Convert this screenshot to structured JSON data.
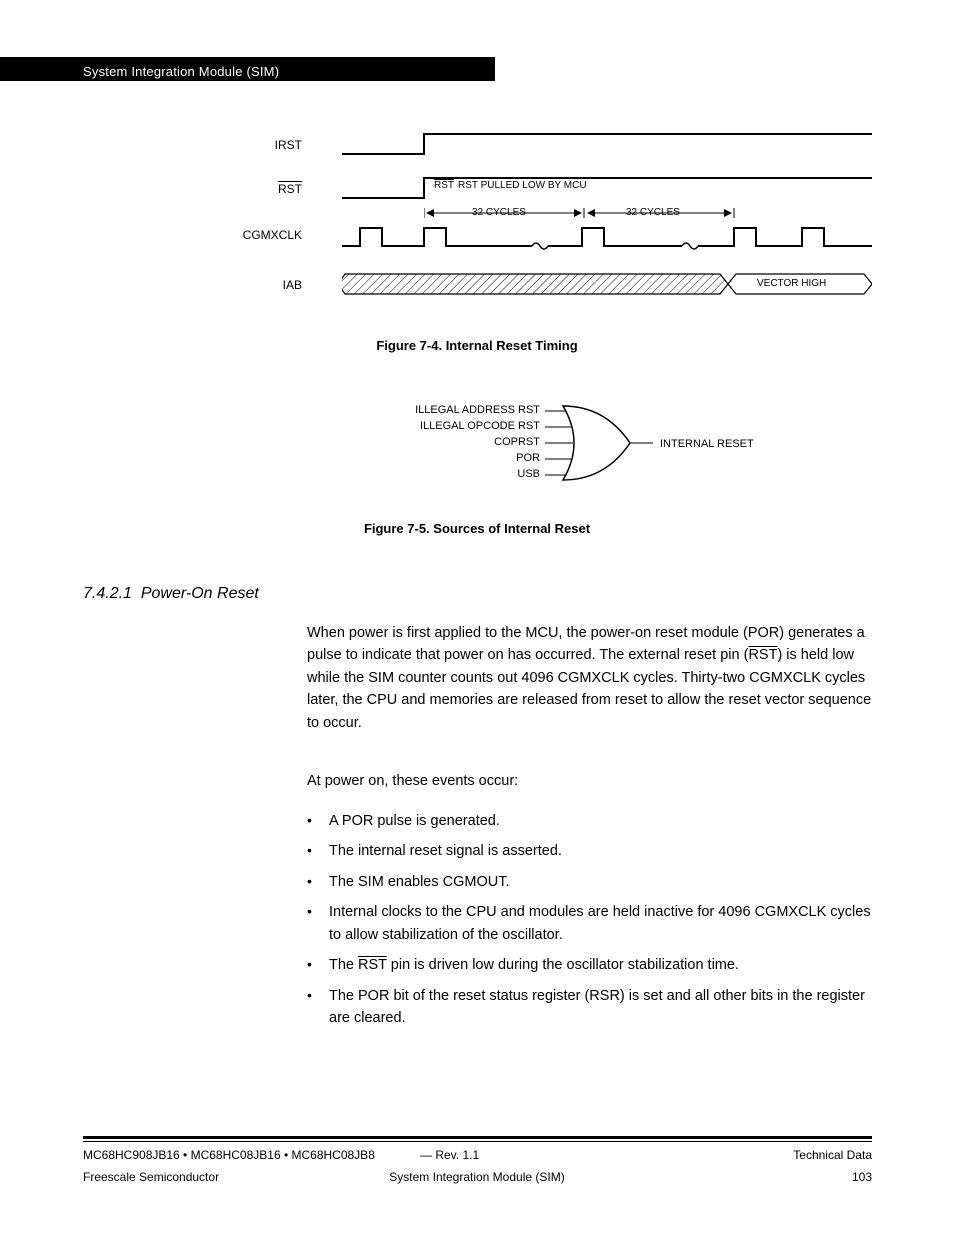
{
  "header": {
    "title": "System Integration Module (SIM)"
  },
  "timing": {
    "signals": {
      "irst": "IRST",
      "rst": "RST",
      "cgmxclk": "CGMXCLK",
      "iab": "IAB"
    },
    "notes": {
      "rst_pulled_low": "RST PULLED LOW BY MCU",
      "cycles_a": "32 CYCLES",
      "cycles_b": "32 CYCLES",
      "vector_high": "VECTOR HIGH"
    },
    "caption": "Figure 7-4. Internal Reset Timing"
  },
  "or_diagram": {
    "inputs": [
      "ILLEGAL ADDRESS RST",
      "ILLEGAL OPCODE RST",
      "COPRST",
      "POR",
      "USB"
    ],
    "output": "INTERNAL RESET",
    "caption": "Figure 7-5. Sources of Internal Reset"
  },
  "section": {
    "number": "7.4.2.1",
    "title": "Power-On Reset"
  },
  "body": {
    "p1_pre": "When power is first applied to the MCU, the power-on reset module (POR) generates a pulse to indicate that power on has occurred. The external reset pin (",
    "p1_rst": "RST",
    "p1_post": ") is held low while the SIM counter counts out 4096 CGMXCLK cycles. Thirty-two CGMXCLK cycles later, the CPU and memories are released from reset to allow the reset vector sequence to occur.",
    "p2": "At power on, these events occur:",
    "b1": "A POR pulse is generated.",
    "b2": "The internal reset signal is asserted.",
    "b3": "The SIM enables CGMOUT.",
    "b4": "Internal clocks to the CPU and modules are held inactive for 4096 CGMXCLK cycles to allow stabilization of the oscillator.",
    "b5_pre": "The ",
    "b5_rst": "RST",
    "b5_post": " pin is driven low during the oscillator stabilization time.",
    "b6": "The POR bit of the reset status register (RSR) is set and all other bits in the register are cleared."
  },
  "footer": {
    "docnum": "MC68HC908JB16  •   MC68HC08JB16  •   MC68HC08JB8",
    "ver": "—  Rev. 1.1",
    "manual": "Technical Data",
    "company": "Freescale Semiconductor",
    "section": "System Integration Module (SIM)",
    "page": "103"
  },
  "chart_data": [
    {
      "type": "timing-diagram",
      "title": "Figure 7-4. Internal Reset Timing",
      "signals": [
        {
          "name": "IRST",
          "values": "low→high (step, stays high)"
        },
        {
          "name": "RST",
          "values": "low→high (step); annotated 'RST PULLED LOW BY MCU' during low"
        },
        {
          "name": "CGMXCLK",
          "values": "clock pulses; two labeled spans of 32 CYCLES each with breaks"
        },
        {
          "name": "IAB",
          "values": "unknown/hatched bus then valid 'VECTOR HIGH'"
        }
      ]
    },
    {
      "type": "diagram",
      "title": "Figure 7-5. Sources of Internal Reset",
      "shape": "5-input OR gate",
      "inputs": [
        "ILLEGAL ADDRESS RST",
        "ILLEGAL OPCODE RST",
        "COPRST",
        "POR",
        "USB"
      ],
      "output": "INTERNAL RESET"
    }
  ]
}
